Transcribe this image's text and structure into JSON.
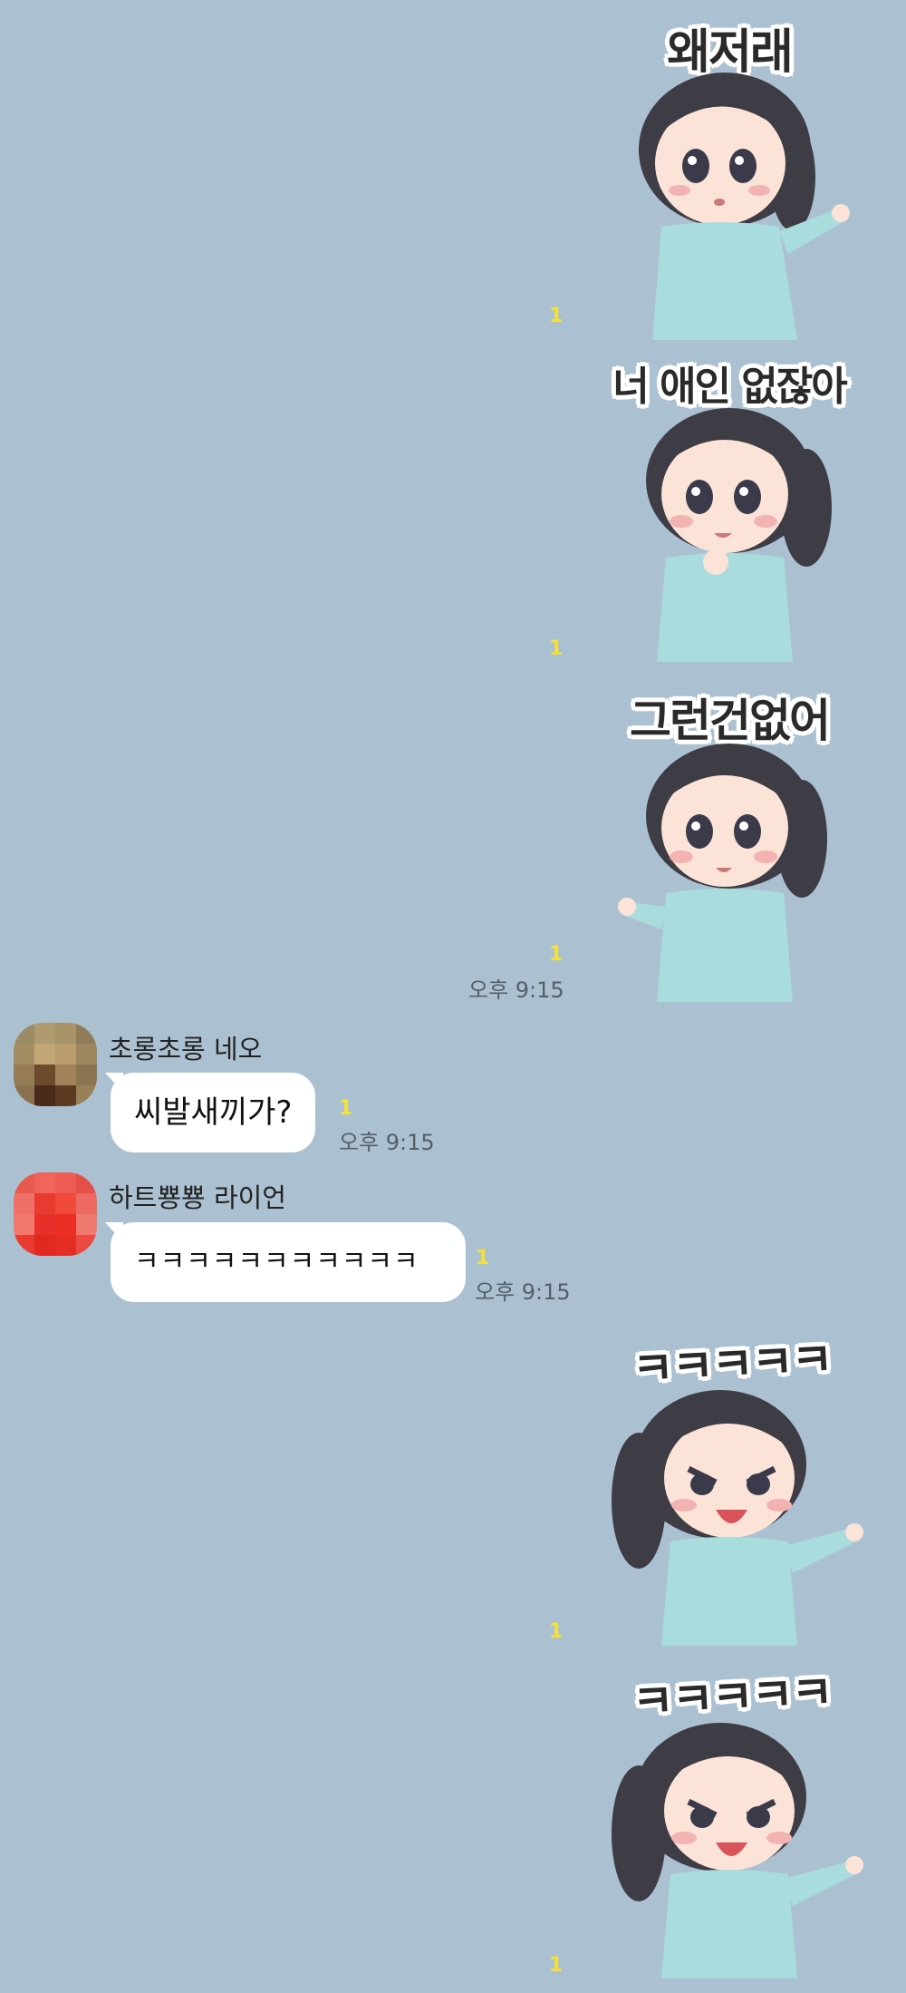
{
  "colors": {
    "background": "#abc1d1",
    "bubble": "#ffffff",
    "unread": "#f5e03a",
    "pajama": "#a9dcdc",
    "hair": "#3e3c44"
  },
  "messages": [
    {
      "type": "sticker",
      "side": "right",
      "caption": "왜저래",
      "unread": "1",
      "icon": "girl-pointing-sticker"
    },
    {
      "type": "sticker",
      "side": "right",
      "caption": "너 애인 없잖아",
      "unread": "1",
      "icon": "girl-smirking-sticker"
    },
    {
      "type": "sticker",
      "side": "right",
      "caption": "그런건없어",
      "unread": "1",
      "time": "오후 9:15",
      "icon": "girl-waving-sticker"
    },
    {
      "type": "text",
      "side": "left",
      "sender": "초롱초롱 네오",
      "text": "씨발새끼가?",
      "unread": "1",
      "time": "오후 9:15"
    },
    {
      "type": "text",
      "side": "left",
      "sender": "하트뿅뿅 라이언",
      "text": "ㅋㅋㅋㅋㅋㅋㅋㅋㅋㅋㅋ",
      "unread": "1",
      "time": "오후 9:15"
    },
    {
      "type": "sticker",
      "side": "right",
      "caption": "ㅋㅋㅋㅋㅋ",
      "unread": "1",
      "icon": "girl-laughing-sticker"
    },
    {
      "type": "sticker",
      "side": "right",
      "caption": "ㅋㅋㅋㅋㅋ",
      "unread": "1",
      "icon": "girl-laughing-sticker"
    }
  ]
}
